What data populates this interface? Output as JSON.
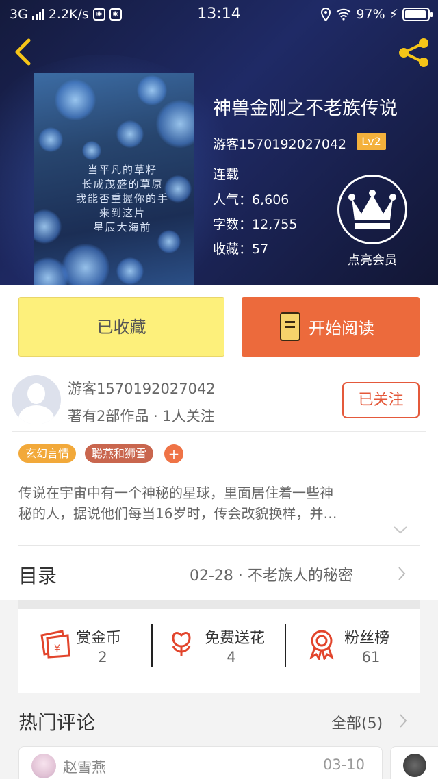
{
  "status_bar": {
    "network": "3G",
    "speed": "2.2K/s",
    "time": "13:14",
    "battery": "97%"
  },
  "book": {
    "title": "神兽金刚之不老族传说",
    "author": "游客1570192027042",
    "level": "Lv2",
    "state": "连载",
    "popularity": "人气：6,606",
    "words": "字数：12,755",
    "favorites": "收藏：57",
    "cover_poem": [
      "当平凡的草籽",
      "长成茂盛的草原",
      "我能否重握你的手",
      "来到这片",
      "星辰大海前"
    ]
  },
  "vip": {
    "label": "点亮会员"
  },
  "actions": {
    "favorited": "已收藏",
    "read": "开始阅读"
  },
  "author_card": {
    "name": "游客1570192027042",
    "meta": "著有2部作品 · 1人关注",
    "follow": "已关注"
  },
  "tags": [
    {
      "label": "玄幻言情",
      "color": "#f2a93a"
    },
    {
      "label": "聪燕和狮雪",
      "color": "#c9664e"
    }
  ],
  "tag_add": "+",
  "description": [
    "传说在宇宙中有一个神秘的星球，里面居住着一些神",
    "秘的人，据说他们每当16岁时，传会改貌换样，并…"
  ],
  "toc": {
    "title": "目录",
    "latest": "02-28 · 不老族人的秘密"
  },
  "stats": [
    {
      "label": "赏金币",
      "value": "2"
    },
    {
      "label": "免费送花",
      "value": "4"
    },
    {
      "label": "粉丝榜",
      "value": "61"
    }
  ],
  "comments": {
    "title": "热门评论",
    "all_label": "全部(5)",
    "items": [
      {
        "name": "赵雪燕",
        "date": "03-10"
      }
    ]
  },
  "colors": {
    "accent": "#ec6a3c",
    "favorite_btn": "#fdf07b",
    "level_badge": "#f4b13c",
    "header_bg": "#1f2a66"
  }
}
